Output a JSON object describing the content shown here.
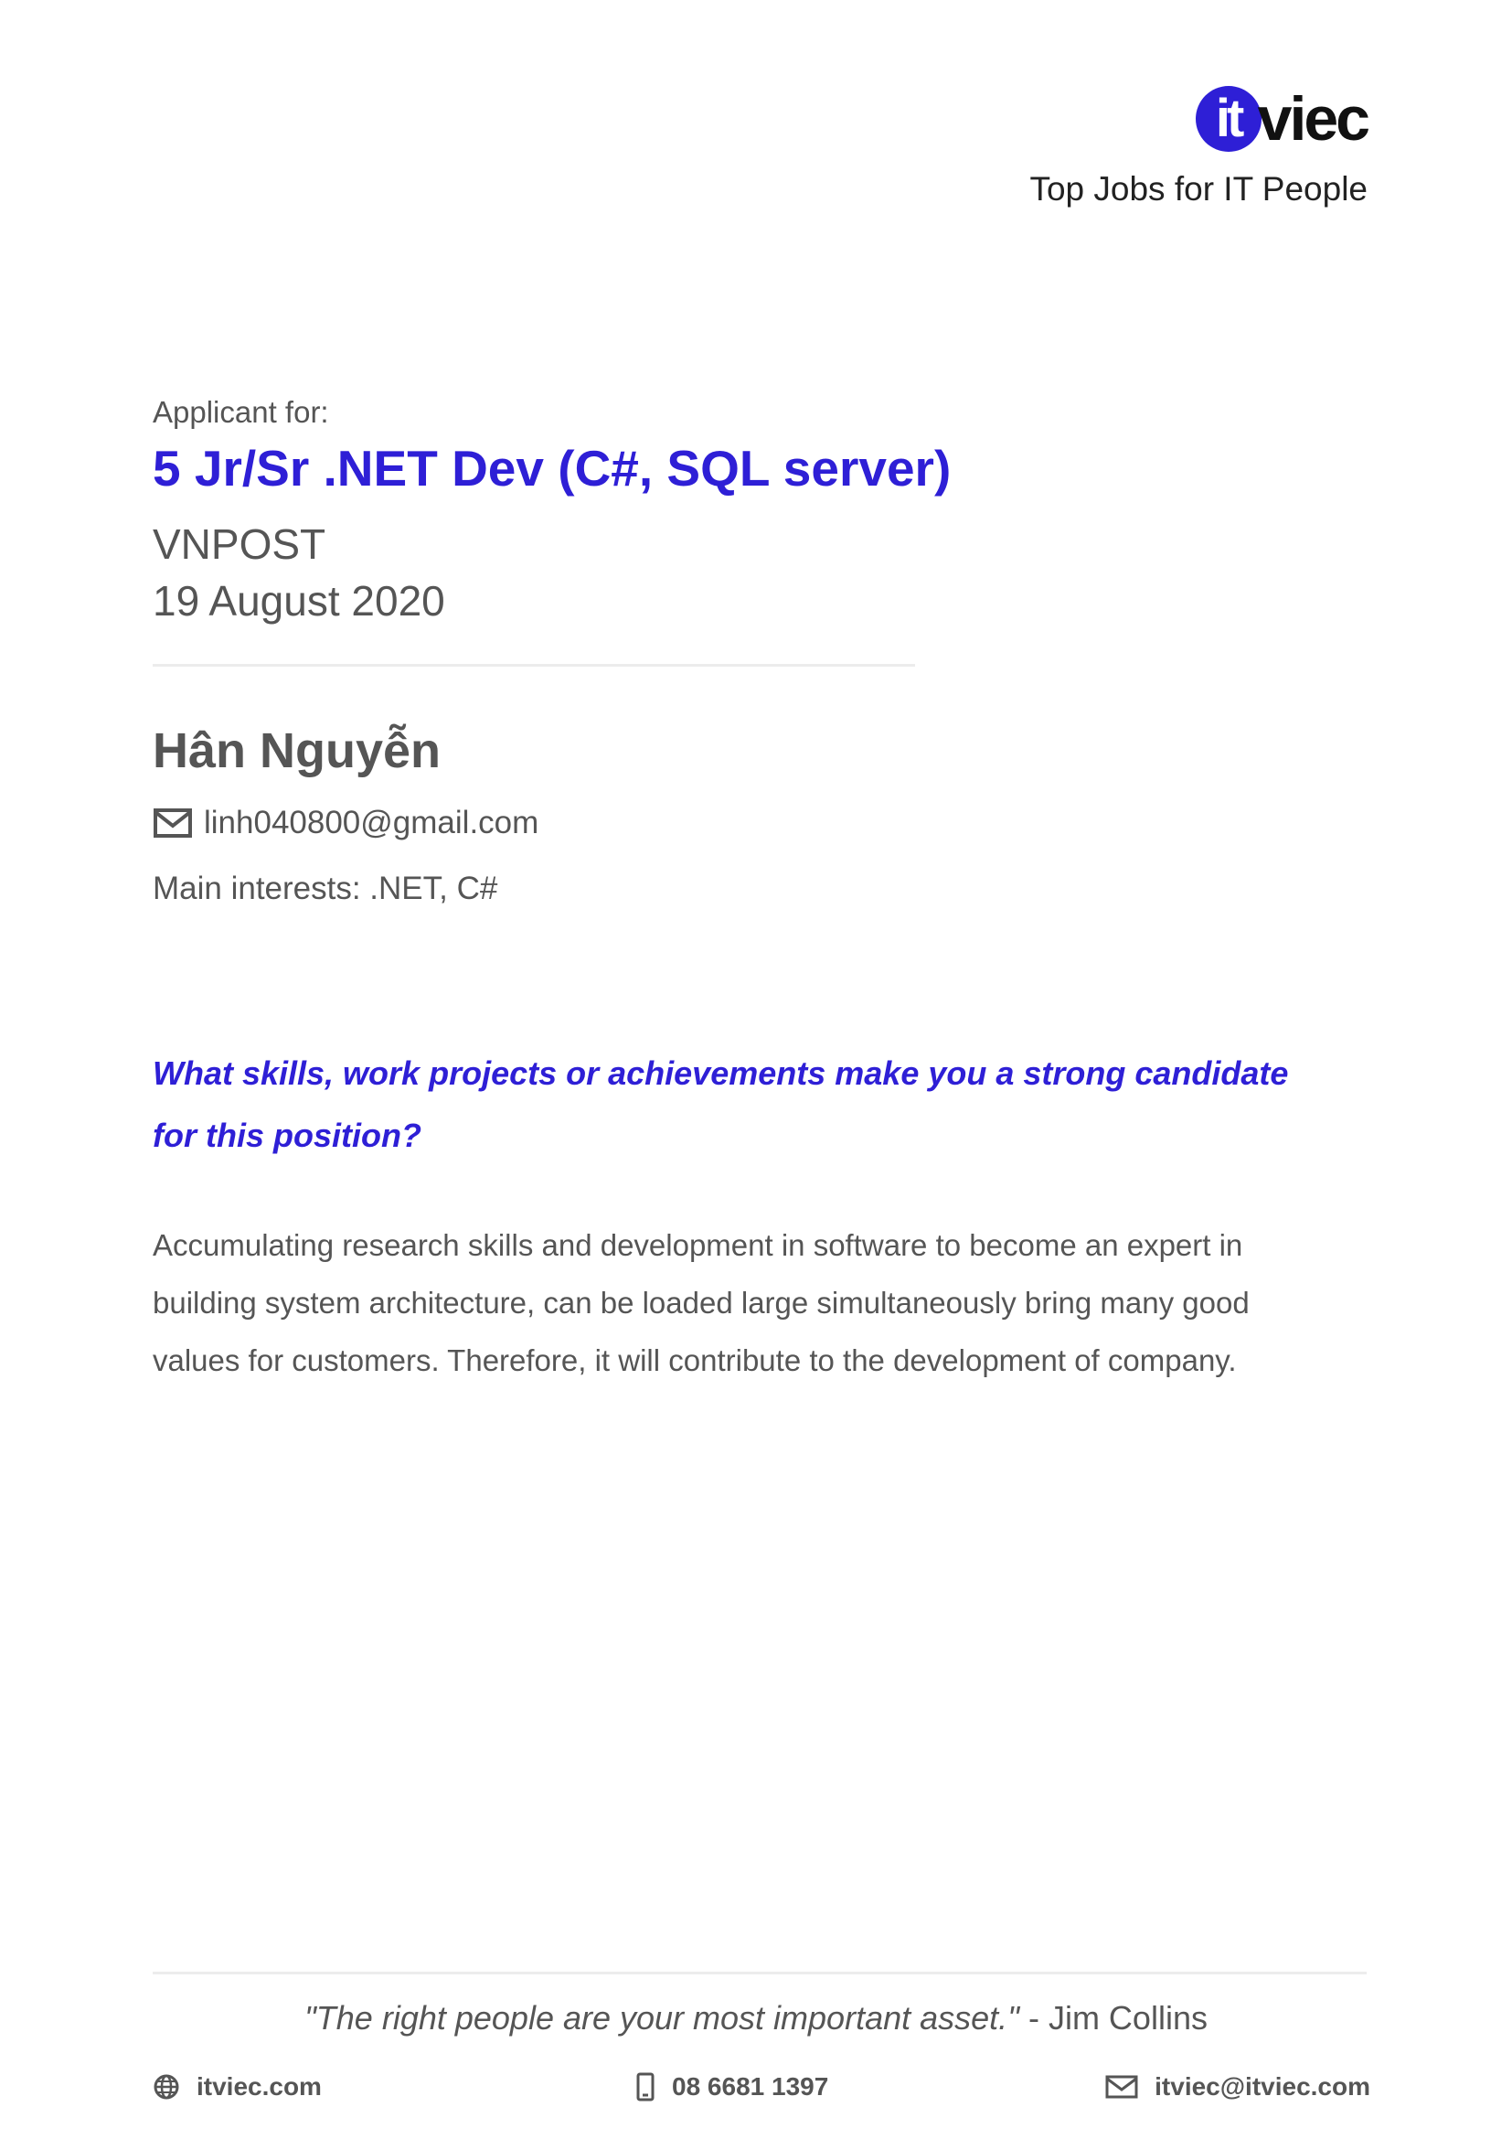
{
  "header": {
    "logo_mark": "it",
    "logo_text": "viec",
    "tagline": "Top Jobs for IT People"
  },
  "job": {
    "applicant_label": "Applicant for:",
    "title": "5 Jr/Sr .NET Dev (C#, SQL server)",
    "company": "VNPOST",
    "date": "19 August 2020"
  },
  "applicant": {
    "name": "Hân Nguyễn",
    "email": "linh040800@gmail.com",
    "interests": "Main interests: .NET, C#"
  },
  "question": {
    "prompt": "What skills, work projects or achievements make you a strong candidate for this position?",
    "answer": "Accumulating research skills and development in software to become an expert in building system architecture, can be loaded large simultaneously bring many good values for customers. Therefore, it will contribute to the development of company."
  },
  "footer": {
    "quote_text": "\"The right people are your most important asset.\"",
    "quote_author": " - Jim Collins",
    "website": "itviec.com",
    "phone": "08 6681 1397",
    "email": "itviec@itviec.com"
  },
  "colors": {
    "brand": "#2e1fd6",
    "text": "#555555",
    "divider": "#ececec"
  },
  "icons": {
    "applicant_email": "envelope-icon",
    "footer_website": "globe-icon",
    "footer_phone": "phone-icon",
    "footer_email": "envelope-icon"
  }
}
